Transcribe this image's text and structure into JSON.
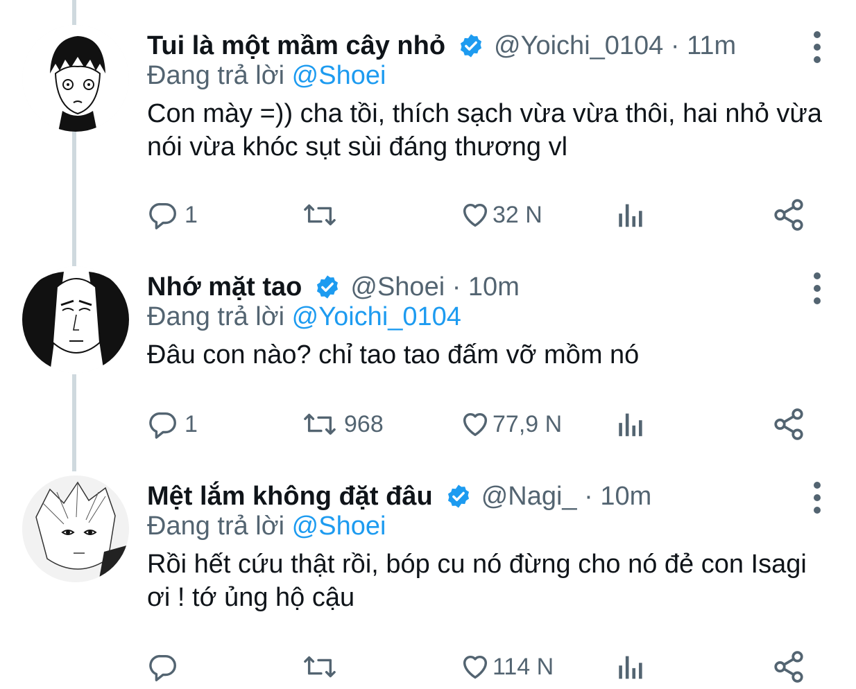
{
  "tweets": [
    {
      "name": "Tui là một mầm cây nhỏ",
      "handle": "@Yoichi_0104",
      "time": "11m",
      "replying_prefix": "Đang trả lời",
      "replying_to": "@Shoei",
      "text": "Con mày =)) cha tồi, thích sạch vừa vừa thôi, hai nhỏ vừa nói vừa khóc sụt sùi đáng thương vl",
      "replies": "1",
      "retweets": "",
      "likes": "32 N"
    },
    {
      "name": "Nhớ mặt tao",
      "handle": "@Shoei",
      "time": "10m",
      "replying_prefix": "Đang trả lời",
      "replying_to": "@Yoichi_0104",
      "text": "Đâu con nào? chỉ tao tao đấm vỡ mồm nó",
      "replies": "1",
      "retweets": "968",
      "likes": "77,9 N"
    },
    {
      "name": "Mệt lắm không đặt đâu",
      "handle": "@Nagi_",
      "time": "10m",
      "replying_prefix": "Đang trả lời",
      "replying_to": "@Shoei",
      "text": "Rồi hết cứu thật rồi, bóp cu nó đừng cho nó đẻ con Isagi ơi ! tớ ủng hộ cậu",
      "replies": "",
      "retweets": "",
      "likes": "114 N"
    }
  ],
  "colors": {
    "accent": "#1d9bf0",
    "muted": "#536471",
    "text": "#0f1419",
    "thread": "#cfd9de"
  },
  "icons": [
    "verified-badge-icon",
    "more-options-icon",
    "reply-icon",
    "retweet-icon",
    "like-icon",
    "analytics-icon",
    "share-icon"
  ]
}
